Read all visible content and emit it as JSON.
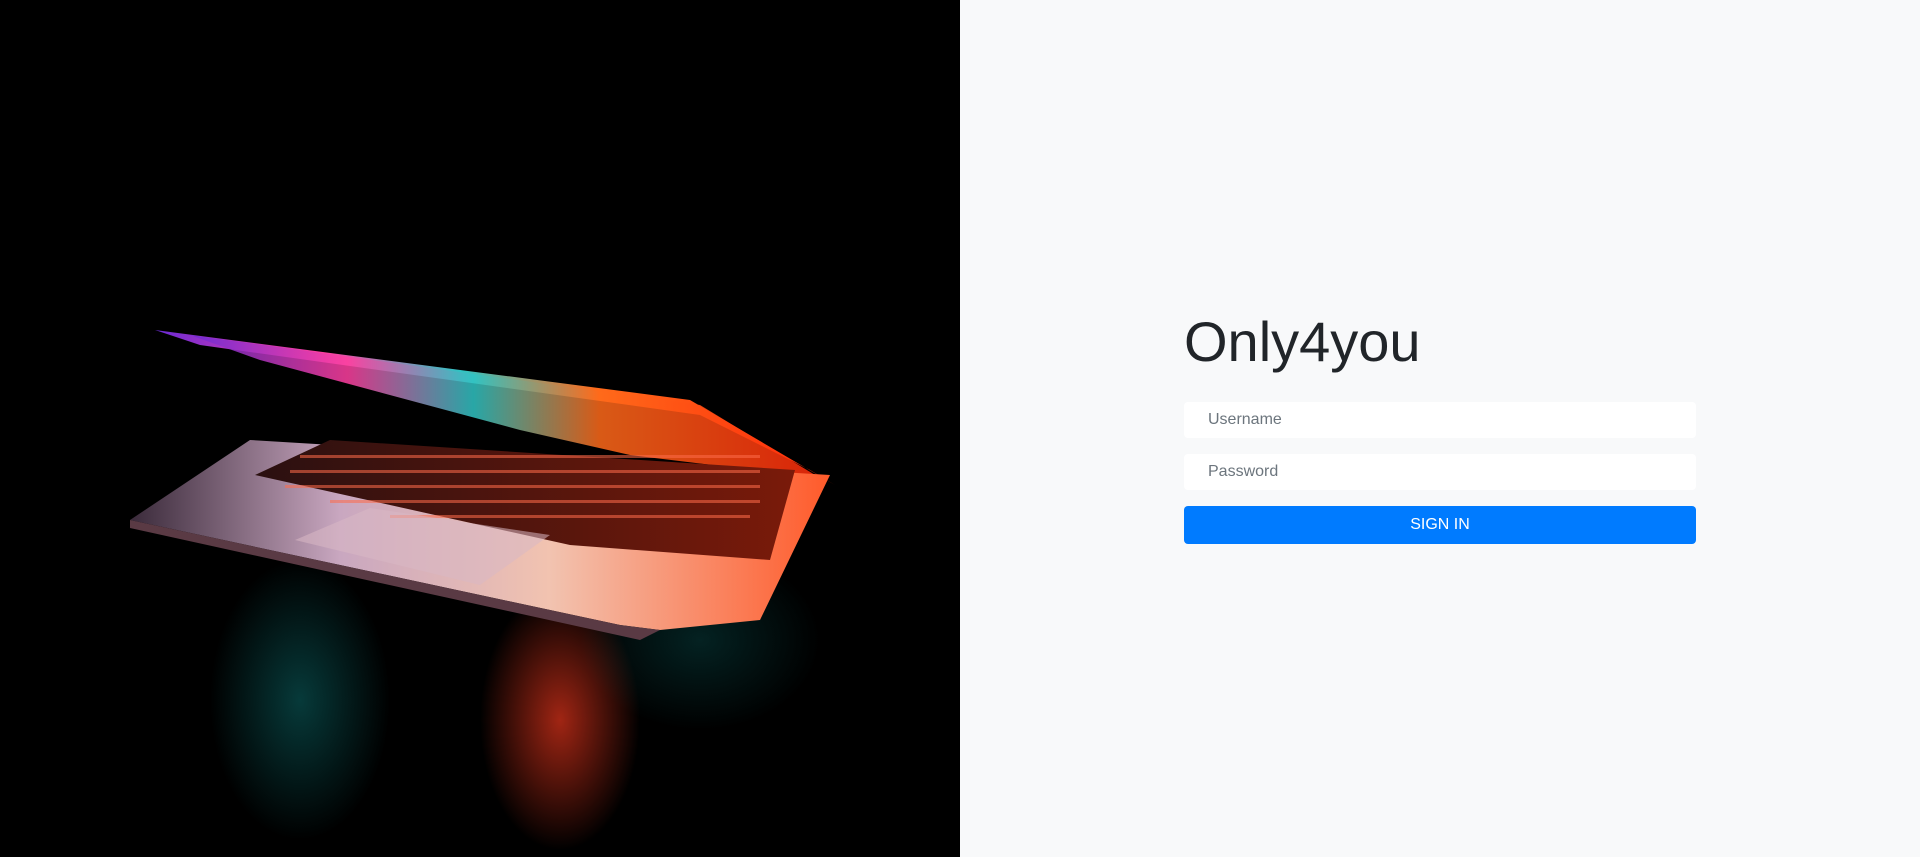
{
  "hero": {
    "image": "laptop-illuminated-photo"
  },
  "login": {
    "brand": "Only4you",
    "username_placeholder": "Username",
    "password_placeholder": "Password",
    "signin_label": "SIGN IN"
  },
  "colors": {
    "accent": "#007bff",
    "panel_bg": "#f8f9fa",
    "hero_bg": "#000000",
    "text": "#212529"
  }
}
